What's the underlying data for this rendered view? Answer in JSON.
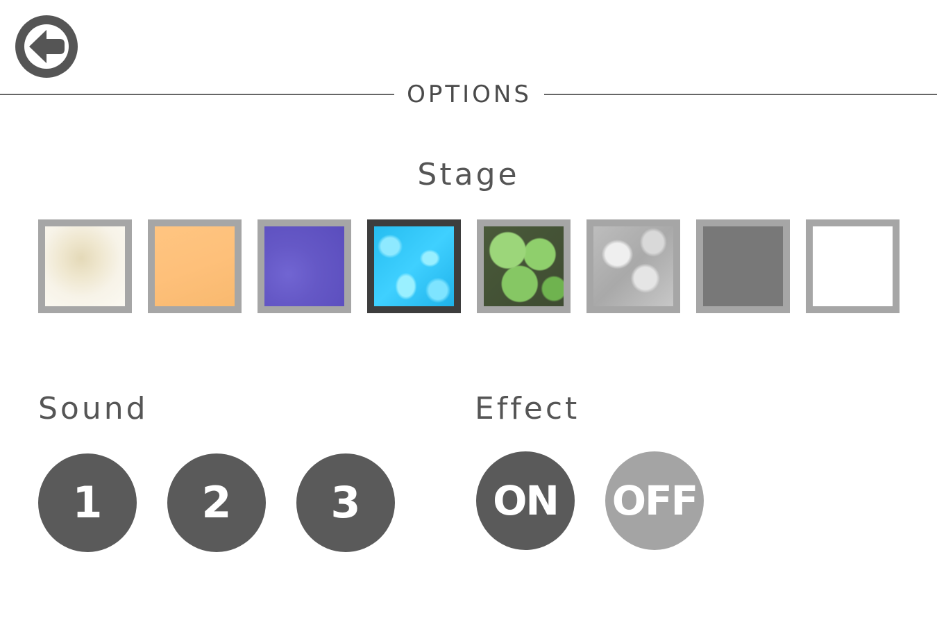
{
  "header": {
    "title": "OPTIONS",
    "back_icon": "back-arrow-icon"
  },
  "stage": {
    "label": "Stage",
    "selected_index": 3,
    "swatches": [
      {
        "name": "cream-marble",
        "color": "#f3ecda"
      },
      {
        "name": "orange-wood",
        "color": "#fec07a"
      },
      {
        "name": "purple-space",
        "color": "#6558c6"
      },
      {
        "name": "blue-water",
        "color": "#2fc4f5"
      },
      {
        "name": "green-clover",
        "color": "#8fcf6c"
      },
      {
        "name": "gray-rock",
        "color": "#c0c0c0"
      },
      {
        "name": "dark-gray",
        "color": "#787878"
      },
      {
        "name": "white",
        "color": "#ffffff"
      }
    ]
  },
  "sound": {
    "label": "Sound",
    "options": [
      "1",
      "2",
      "3"
    ]
  },
  "effect": {
    "label": "Effect",
    "on_label": "ON",
    "off_label": "OFF",
    "selected": "ON"
  },
  "colors": {
    "button_dark": "#5a5a5a",
    "button_inactive": "#a4a4a4",
    "swatch_border": "#a6a6a6",
    "swatch_border_selected": "#3d3d3d",
    "text": "#555555"
  }
}
